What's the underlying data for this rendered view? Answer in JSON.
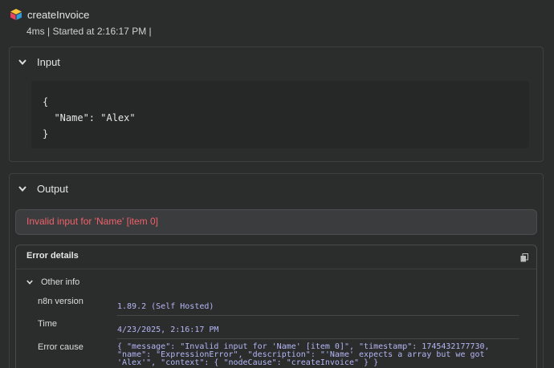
{
  "node": {
    "title": "createInvoice",
    "meta": "4ms | Started at 2:16:17 PM |"
  },
  "input": {
    "title": "Input",
    "code_lines": [
      "{",
      "  \"Name\": \"Alex\"",
      "}"
    ]
  },
  "output": {
    "title": "Output",
    "error_message": "Invalid input for 'Name' [item 0]",
    "details_title": "Error details",
    "other_info_label": "Other info",
    "rows": [
      {
        "label": "n8n version",
        "value": "1.89.2 (Self Hosted)"
      },
      {
        "label": "Time",
        "value": "4/23/2025, 2:16:17 PM"
      },
      {
        "label": "Error cause",
        "value_lines": [
          "{ \"message\": \"Invalid input for 'Name' [item 0]\", \"timestamp\": 1745432177730,",
          "\"name\": \"ExpressionError\", \"description\": \"'Name' expects a array but we got",
          "'Alex'\", \"context\": { \"nodeCause\": \"createInvoice\" } }"
        ]
      }
    ]
  },
  "colors": {
    "background": "#2b2d2d",
    "error_text": "#f0616b",
    "value_text": "#b4b6f5"
  },
  "icons": [
    "node-logo-icon",
    "chevron-down-icon",
    "copy-icon"
  ]
}
